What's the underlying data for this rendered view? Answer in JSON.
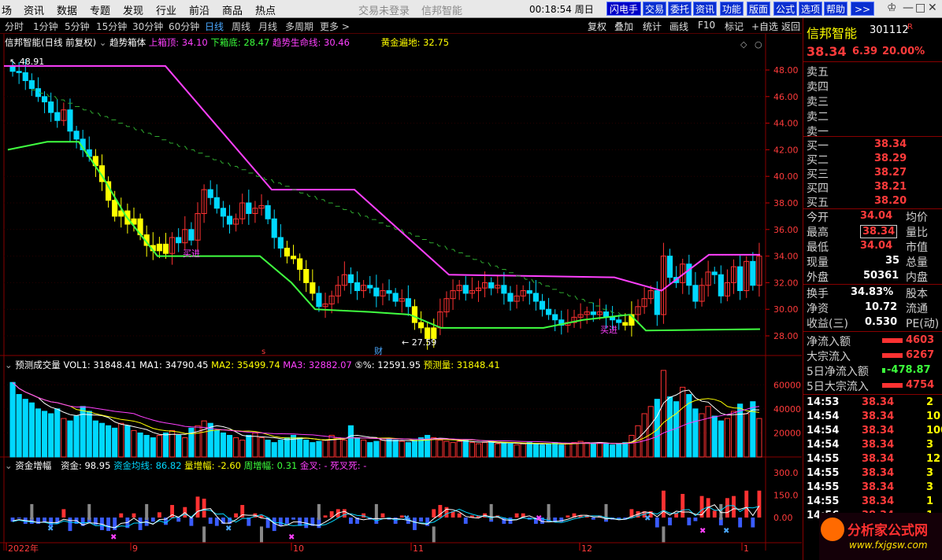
{
  "menu": [
    "场",
    "资讯",
    "数据",
    "专题",
    "发现",
    "行业",
    "前沿",
    "商品",
    "热点"
  ],
  "menu_gray": [
    "交易未登录",
    "信邦智能"
  ],
  "clock": "00:18:54",
  "weekday": "周日",
  "topbuttons": [
    "闪电手",
    "交易",
    "委托",
    "资讯",
    "功能",
    "版面",
    "公式",
    "选项",
    "帮助",
    ">>"
  ],
  "window_controls": [
    "♔",
    "—",
    "□",
    "✕"
  ],
  "periods": [
    "分时",
    "1分钟",
    "5分钟",
    "15分钟",
    "30分钟",
    "60分钟",
    "日线",
    "周线",
    "月线",
    "多周期",
    "更多 >"
  ],
  "active_period": "日线",
  "right_tools": [
    "复权",
    "叠加",
    "统计",
    "画线",
    "F10",
    "标记",
    "+自选",
    "返回"
  ],
  "legend_main": {
    "name": "信邦智能(日线 前复权)",
    "indicator": "趋势箱体",
    "top_label": "上箱顶: 34.10",
    "bot_label": "下箱底: 28.47",
    "life_label": "趋势生命线: 30.46",
    "gold_label": "黄金遍地: 32.75"
  },
  "legend_vol": {
    "name": "预测成交量",
    "vol1": "VOL1: 31848.41",
    "ma1": "MA1: 34790.45",
    "ma2": "MA2: 35499.74",
    "ma3": "MA3: 32882.07",
    "pct": "⑤%: 12591.95",
    "pred": "预测量: 31848.41"
  },
  "legend_money": {
    "name": "资金增幅",
    "money": "资金: 98.95",
    "avg": "资金均线: 86.82",
    "lz": "量增幅: -2.60",
    "wz": "周增幅: 0.31",
    "jc": "金叉: -",
    "sc": "死叉死: -"
  },
  "price_axis": [
    "48.00",
    "46.00",
    "44.00",
    "42.00",
    "40.00",
    "38.00",
    "36.00",
    "34.00",
    "32.00",
    "30.00",
    "28.00"
  ],
  "vol_axis": [
    "60000",
    "40000",
    "20000"
  ],
  "money_axis": [
    "300.0",
    "150.0",
    "0.00"
  ],
  "date_labels": [
    "2022年",
    "9",
    "10",
    "11",
    "12",
    "1"
  ],
  "annotations": {
    "high": "48.91",
    "low": "27.59",
    "buy1": "买进",
    "buy2": "买进",
    "cai": "财",
    "s": "s"
  },
  "stock": {
    "name": "信邦智能",
    "code": "301112",
    "mark": "R",
    "price": "38.34",
    "change": "6.39",
    "pct": "20.00%"
  },
  "sell": [
    "卖五",
    "卖四",
    "卖三",
    "卖二",
    "卖一"
  ],
  "buy": [
    {
      "label": "买一",
      "price": "38.34"
    },
    {
      "label": "买二",
      "price": "38.29"
    },
    {
      "label": "买三",
      "price": "38.27"
    },
    {
      "label": "买四",
      "price": "38.21"
    },
    {
      "label": "买五",
      "price": "38.20"
    }
  ],
  "stats": [
    {
      "l": "今开",
      "v": "34.04",
      "l2": "均价"
    },
    {
      "l": "最高",
      "v": "38.34",
      "l2": "量比"
    },
    {
      "l": "最低",
      "v": "34.04",
      "l2": "市值"
    },
    {
      "l": "现量",
      "v": "35",
      "l2": "总量"
    },
    {
      "l": "外盘",
      "v": "50361",
      "l2": "内盘"
    }
  ],
  "stats2": [
    {
      "l": "换手",
      "v": "34.83%",
      "l2": "股本"
    },
    {
      "l": "净资",
      "v": "10.72",
      "l2": "流通"
    },
    {
      "l": "收益(三)",
      "v": "0.530",
      "l2": "PE(动)"
    }
  ],
  "flows": [
    {
      "l": "净流入额",
      "v": "4603"
    },
    {
      "l": "大宗流入",
      "v": "6267"
    },
    {
      "l": "5日净流入额",
      "v": "-478.87"
    },
    {
      "l": "5日大宗流入",
      "v": "4754"
    }
  ],
  "ticks": [
    {
      "t": "14:53",
      "p": "38.34",
      "v": "2"
    },
    {
      "t": "14:54",
      "p": "38.34",
      "v": "10"
    },
    {
      "t": "14:54",
      "p": "38.34",
      "v": "100"
    },
    {
      "t": "14:54",
      "p": "38.34",
      "v": "3"
    },
    {
      "t": "14:55",
      "p": "38.34",
      "v": "12"
    },
    {
      "t": "14:55",
      "p": "38.34",
      "v": "3"
    },
    {
      "t": "14:55",
      "p": "38.34",
      "v": "3"
    },
    {
      "t": "14:55",
      "p": "38.34",
      "v": "1"
    },
    {
      "t": "14:56",
      "p": "38.34",
      "v": "1"
    }
  ],
  "watermark": {
    "cn": "分析家公式网",
    "url": "www.fxjgsw.com"
  },
  "colors": {
    "up": "#ff3232",
    "down": "#00d8ff",
    "box": "#ff40ff",
    "life": "#40ff40",
    "gold": "#ffff00"
  }
}
